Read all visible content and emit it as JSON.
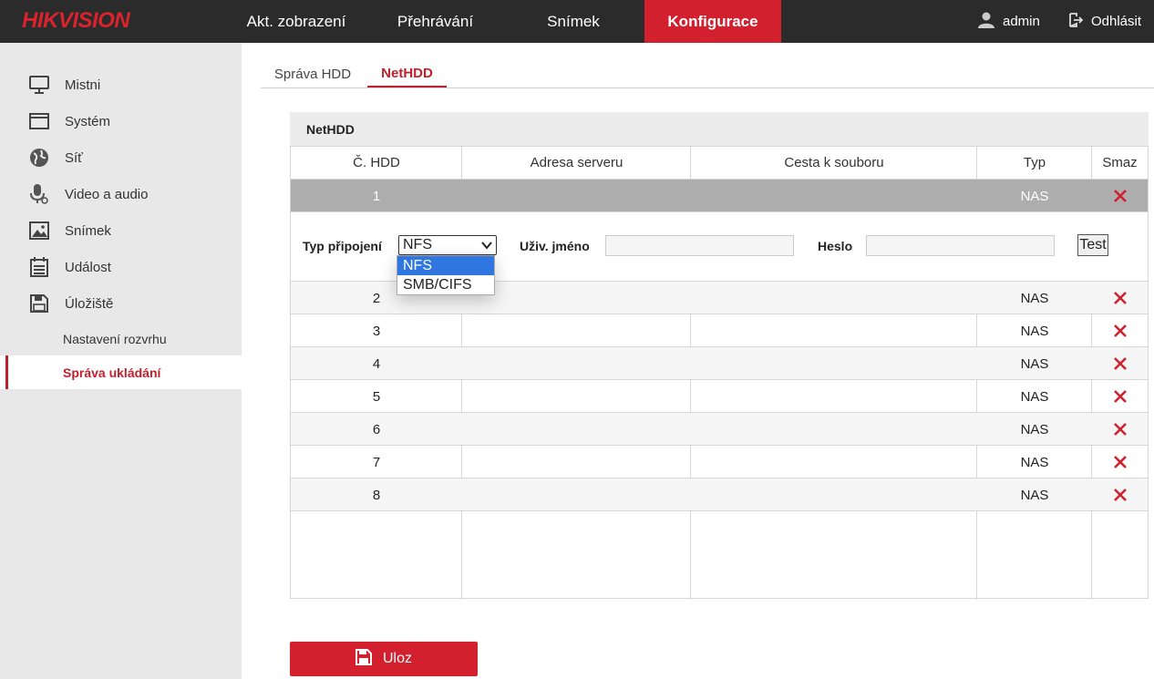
{
  "brand": {
    "logo": "HIKVISION",
    "accent": "#d2202e"
  },
  "topnav": {
    "items": [
      "Akt. zobrazení",
      "Přehrávání",
      "Snímek",
      "Konfigurace"
    ],
    "active": "Konfigurace",
    "user": "admin",
    "logout": "Odhlásit"
  },
  "sidebar": {
    "items": [
      {
        "label": "Mistni",
        "icon": "monitor-icon"
      },
      {
        "label": "Systém",
        "icon": "system-icon"
      },
      {
        "label": "Síť",
        "icon": "globe-icon"
      },
      {
        "label": "Video a audio",
        "icon": "microphone-icon"
      },
      {
        "label": "Snímek",
        "icon": "image-icon"
      },
      {
        "label": "Událost",
        "icon": "calendar-icon"
      },
      {
        "label": "Úložiště",
        "icon": "floppy-icon"
      }
    ],
    "subitems": [
      {
        "label": "Nastavení rozvrhu"
      },
      {
        "label": "Správa ukládání",
        "active": true
      }
    ]
  },
  "tabs": {
    "items": [
      "Správa HDD",
      "NetHDD"
    ],
    "active": "NetHDD"
  },
  "panel": {
    "title": "NetHDD",
    "columns": [
      "Č. HDD",
      "Adresa serveru",
      "Cesta k souboru",
      "Typ",
      "Smaz"
    ],
    "rows": [
      {
        "no": "1",
        "server": "",
        "path": "",
        "type": "NAS"
      },
      {
        "no": "2",
        "server": "",
        "path": "",
        "type": "NAS"
      },
      {
        "no": "3",
        "server": "",
        "path": "",
        "type": "NAS"
      },
      {
        "no": "4",
        "server": "",
        "path": "",
        "type": "NAS"
      },
      {
        "no": "5",
        "server": "",
        "path": "",
        "type": "NAS"
      },
      {
        "no": "6",
        "server": "",
        "path": "",
        "type": "NAS"
      },
      {
        "no": "7",
        "server": "",
        "path": "",
        "type": "NAS"
      },
      {
        "no": "8",
        "server": "",
        "path": "",
        "type": "NAS"
      }
    ],
    "edit": {
      "connection_label": "Typ připojení",
      "connection_value": "NFS",
      "connection_options": [
        "NFS",
        "SMB/CIFS"
      ],
      "username_label": "Uživ. jméno",
      "username_value": "",
      "password_label": "Heslo",
      "password_value": "",
      "test_label": "Test"
    }
  },
  "save": {
    "label": "Uloz"
  }
}
